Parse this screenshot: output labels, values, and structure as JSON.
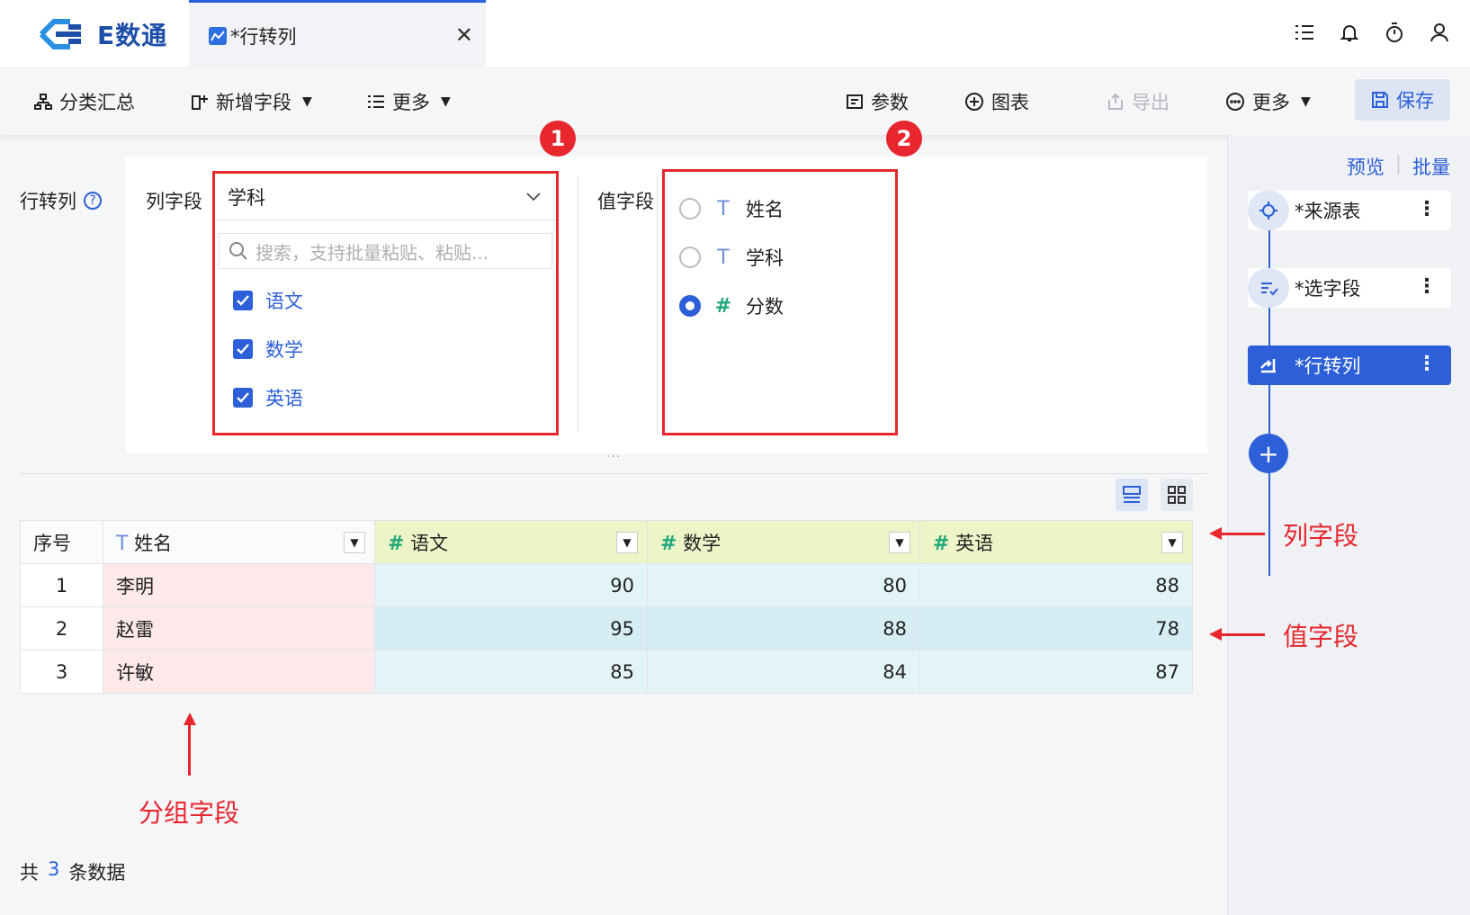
{
  "app": {
    "logo_text": "E数通"
  },
  "tab": {
    "label": "*行转列",
    "close": "✕"
  },
  "toolbar": {
    "classify": "分类汇总",
    "add_field": "新增字段",
    "more_left": "更多",
    "params": "参数",
    "chart": "图表",
    "export": "导出",
    "more_right": "更多",
    "save": "保存"
  },
  "right_panel": {
    "preview": "预览",
    "batch": "批量",
    "nodes": [
      {
        "label": "*来源表",
        "active": false
      },
      {
        "label": "*选字段",
        "active": false
      },
      {
        "label": "*行转列",
        "active": true
      }
    ],
    "add": "+"
  },
  "config": {
    "title": "行转列",
    "help": "?",
    "col_label": "列字段",
    "col_selected": "学科",
    "search_placeholder": "搜索，支持批量粘贴、粘贴...",
    "col_options": [
      "语文",
      "数学",
      "英语"
    ],
    "val_label": "值字段",
    "val_options": [
      {
        "type": "T",
        "label": "姓名",
        "checked": false
      },
      {
        "type": "T",
        "label": "学科",
        "checked": false
      },
      {
        "type": "#",
        "label": "分数",
        "checked": true
      }
    ],
    "badge1": "1",
    "badge2": "2",
    "dots": "···"
  },
  "table": {
    "headers": [
      {
        "type": "",
        "label": "序号"
      },
      {
        "type": "T",
        "label": "姓名"
      },
      {
        "type": "#",
        "label": "语文"
      },
      {
        "type": "#",
        "label": "数学"
      },
      {
        "type": "#",
        "label": "英语"
      }
    ],
    "rows": [
      [
        "1",
        "李明",
        "90",
        "80",
        "88"
      ],
      [
        "2",
        "赵雷",
        "95",
        "88",
        "78"
      ],
      [
        "3",
        "许敏",
        "85",
        "84",
        "87"
      ]
    ]
  },
  "annotations": {
    "col_field": "列字段",
    "val_field": "值字段",
    "group_field": "分组字段"
  },
  "footer": {
    "prefix": "共",
    "count": "3",
    "suffix": "条数据"
  },
  "colors": {
    "accent": "#2c5fd8",
    "annot_red": "#e8262e"
  }
}
